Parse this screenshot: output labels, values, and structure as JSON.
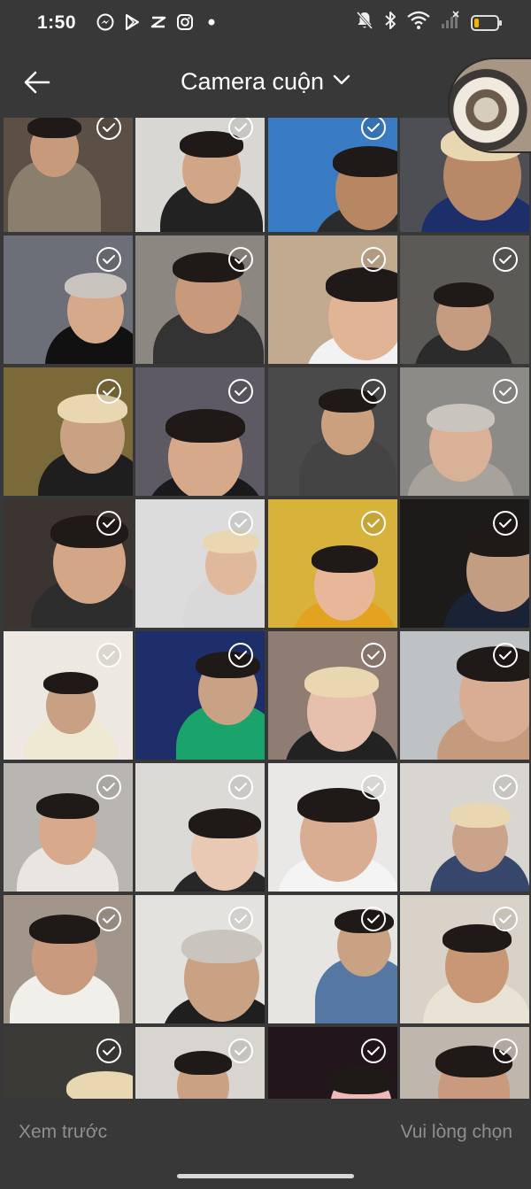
{
  "status_bar": {
    "time": "1:50",
    "app_icons": [
      "messenger-icon",
      "play-store-icon",
      "capcut-icon",
      "instagram-icon",
      "dot-icon"
    ],
    "battery_level": 0.2,
    "battery_color": "#f2b400"
  },
  "header": {
    "title": "Camera cuộn",
    "back_icon": "arrow-left-icon",
    "dropdown_icon": "chevron-down-icon"
  },
  "grid": {
    "columns": 4,
    "tiles": [
      {
        "bg": "#5b4f46",
        "skin": "#c69a7b",
        "shirt": "#8a7f6c",
        "selected": true
      },
      {
        "bg": "#d9d7d3",
        "skin": "#d1a687",
        "shirt": "#222222",
        "selected": true
      },
      {
        "bg": "#3a7cc4",
        "skin": "#b78763",
        "shirt": "#2b2b2b",
        "selected": true
      },
      {
        "bg": "#4d4f55",
        "skin": "#b88968",
        "shirt": "#1d2f6b",
        "selected": true
      },
      {
        "bg": "#6d6f78",
        "skin": "#d6a98a",
        "shirt": "#111111",
        "selected": true
      },
      {
        "bg": "#8c8780",
        "skin": "#c8997a",
        "shirt": "#333333",
        "selected": true
      },
      {
        "bg": "#c1aa8e",
        "skin": "#e0b495",
        "shirt": "#f2f2f2",
        "selected": true
      },
      {
        "bg": "#5c5a57",
        "skin": "#c59c80",
        "shirt": "#2b2b2b",
        "selected": true
      },
      {
        "bg": "#7a6a3a",
        "skin": "#c9a183",
        "shirt": "#1e1e1e",
        "selected": true
      },
      {
        "bg": "#5e5a63",
        "skin": "#d6a98a",
        "shirt": "#1a1a1a",
        "selected": true
      },
      {
        "bg": "#4a4a4a",
        "skin": "#caa07f",
        "shirt": "#444444",
        "selected": true
      },
      {
        "bg": "#8d8b88",
        "skin": "#d8b196",
        "shirt": "#a7a29b",
        "selected": true
      },
      {
        "bg": "#3c3430",
        "skin": "#d4a688",
        "shirt": "#2d2d2d",
        "selected": true
      },
      {
        "bg": "#dcdcdc",
        "skin": "#e0b89c",
        "shirt": "#d9d9d9",
        "selected": true
      },
      {
        "bg": "#d8b23b",
        "skin": "#e8b79a",
        "shirt": "#e2a31f",
        "selected": true
      },
      {
        "bg": "#1d1a1a",
        "skin": "#c29d82",
        "shirt": "#1a2236",
        "selected": true
      },
      {
        "bg": "#ede9e2",
        "skin": "#c8a084",
        "shirt": "#efe8d2",
        "selected": true
      },
      {
        "bg": "#1e2e6a",
        "skin": "#c9a184",
        "shirt": "#1aa36a",
        "selected": true
      },
      {
        "bg": "#8f7d74",
        "skin": "#e6c0ac",
        "shirt": "#222222",
        "selected": true
      },
      {
        "bg": "#bfc2c4",
        "skin": "#d9ad94",
        "shirt": "#c59a7d",
        "selected": true
      },
      {
        "bg": "#b9b5b0",
        "skin": "#d9a98c",
        "shirt": "#e9e6e1",
        "selected": true
      },
      {
        "bg": "#dcdad6",
        "skin": "#e9c9b4",
        "shirt": "#272727",
        "selected": true
      },
      {
        "bg": "#e9e8e6",
        "skin": "#d9ad92",
        "shirt": "#f4f4f4",
        "selected": true
      },
      {
        "bg": "#d9d6d1",
        "skin": "#caa38a",
        "shirt": "#37476b",
        "selected": true
      },
      {
        "bg": "#a2968a",
        "skin": "#c99a7e",
        "shirt": "#f1efe9",
        "selected": true
      },
      {
        "bg": "#e3e2df",
        "skin": "#c9a183",
        "shirt": "#1f1f1f",
        "selected": true
      },
      {
        "bg": "#e6e5e2",
        "skin": "#c9a183",
        "shirt": "#5578a3",
        "selected": true
      },
      {
        "bg": "#d8d2c8",
        "skin": "#c89776",
        "shirt": "#e8e3d4",
        "selected": true
      },
      {
        "bg": "#3b3a36",
        "skin": "#d3a789",
        "shirt": "#ffffff",
        "selected": true
      },
      {
        "bg": "#d8d4cf",
        "skin": "#caa183",
        "shirt": "#ffffff",
        "selected": true
      },
      {
        "bg": "#23151c",
        "skin": "#efb9b8",
        "shirt": "#e06f99",
        "selected": true
      },
      {
        "bg": "#bfb7ad",
        "skin": "#c99a7e",
        "shirt": "#f1f0ec",
        "selected": true
      }
    ]
  },
  "bottom_bar": {
    "preview_label": "Xem trước",
    "select_label": "Vui lòng chọn"
  }
}
